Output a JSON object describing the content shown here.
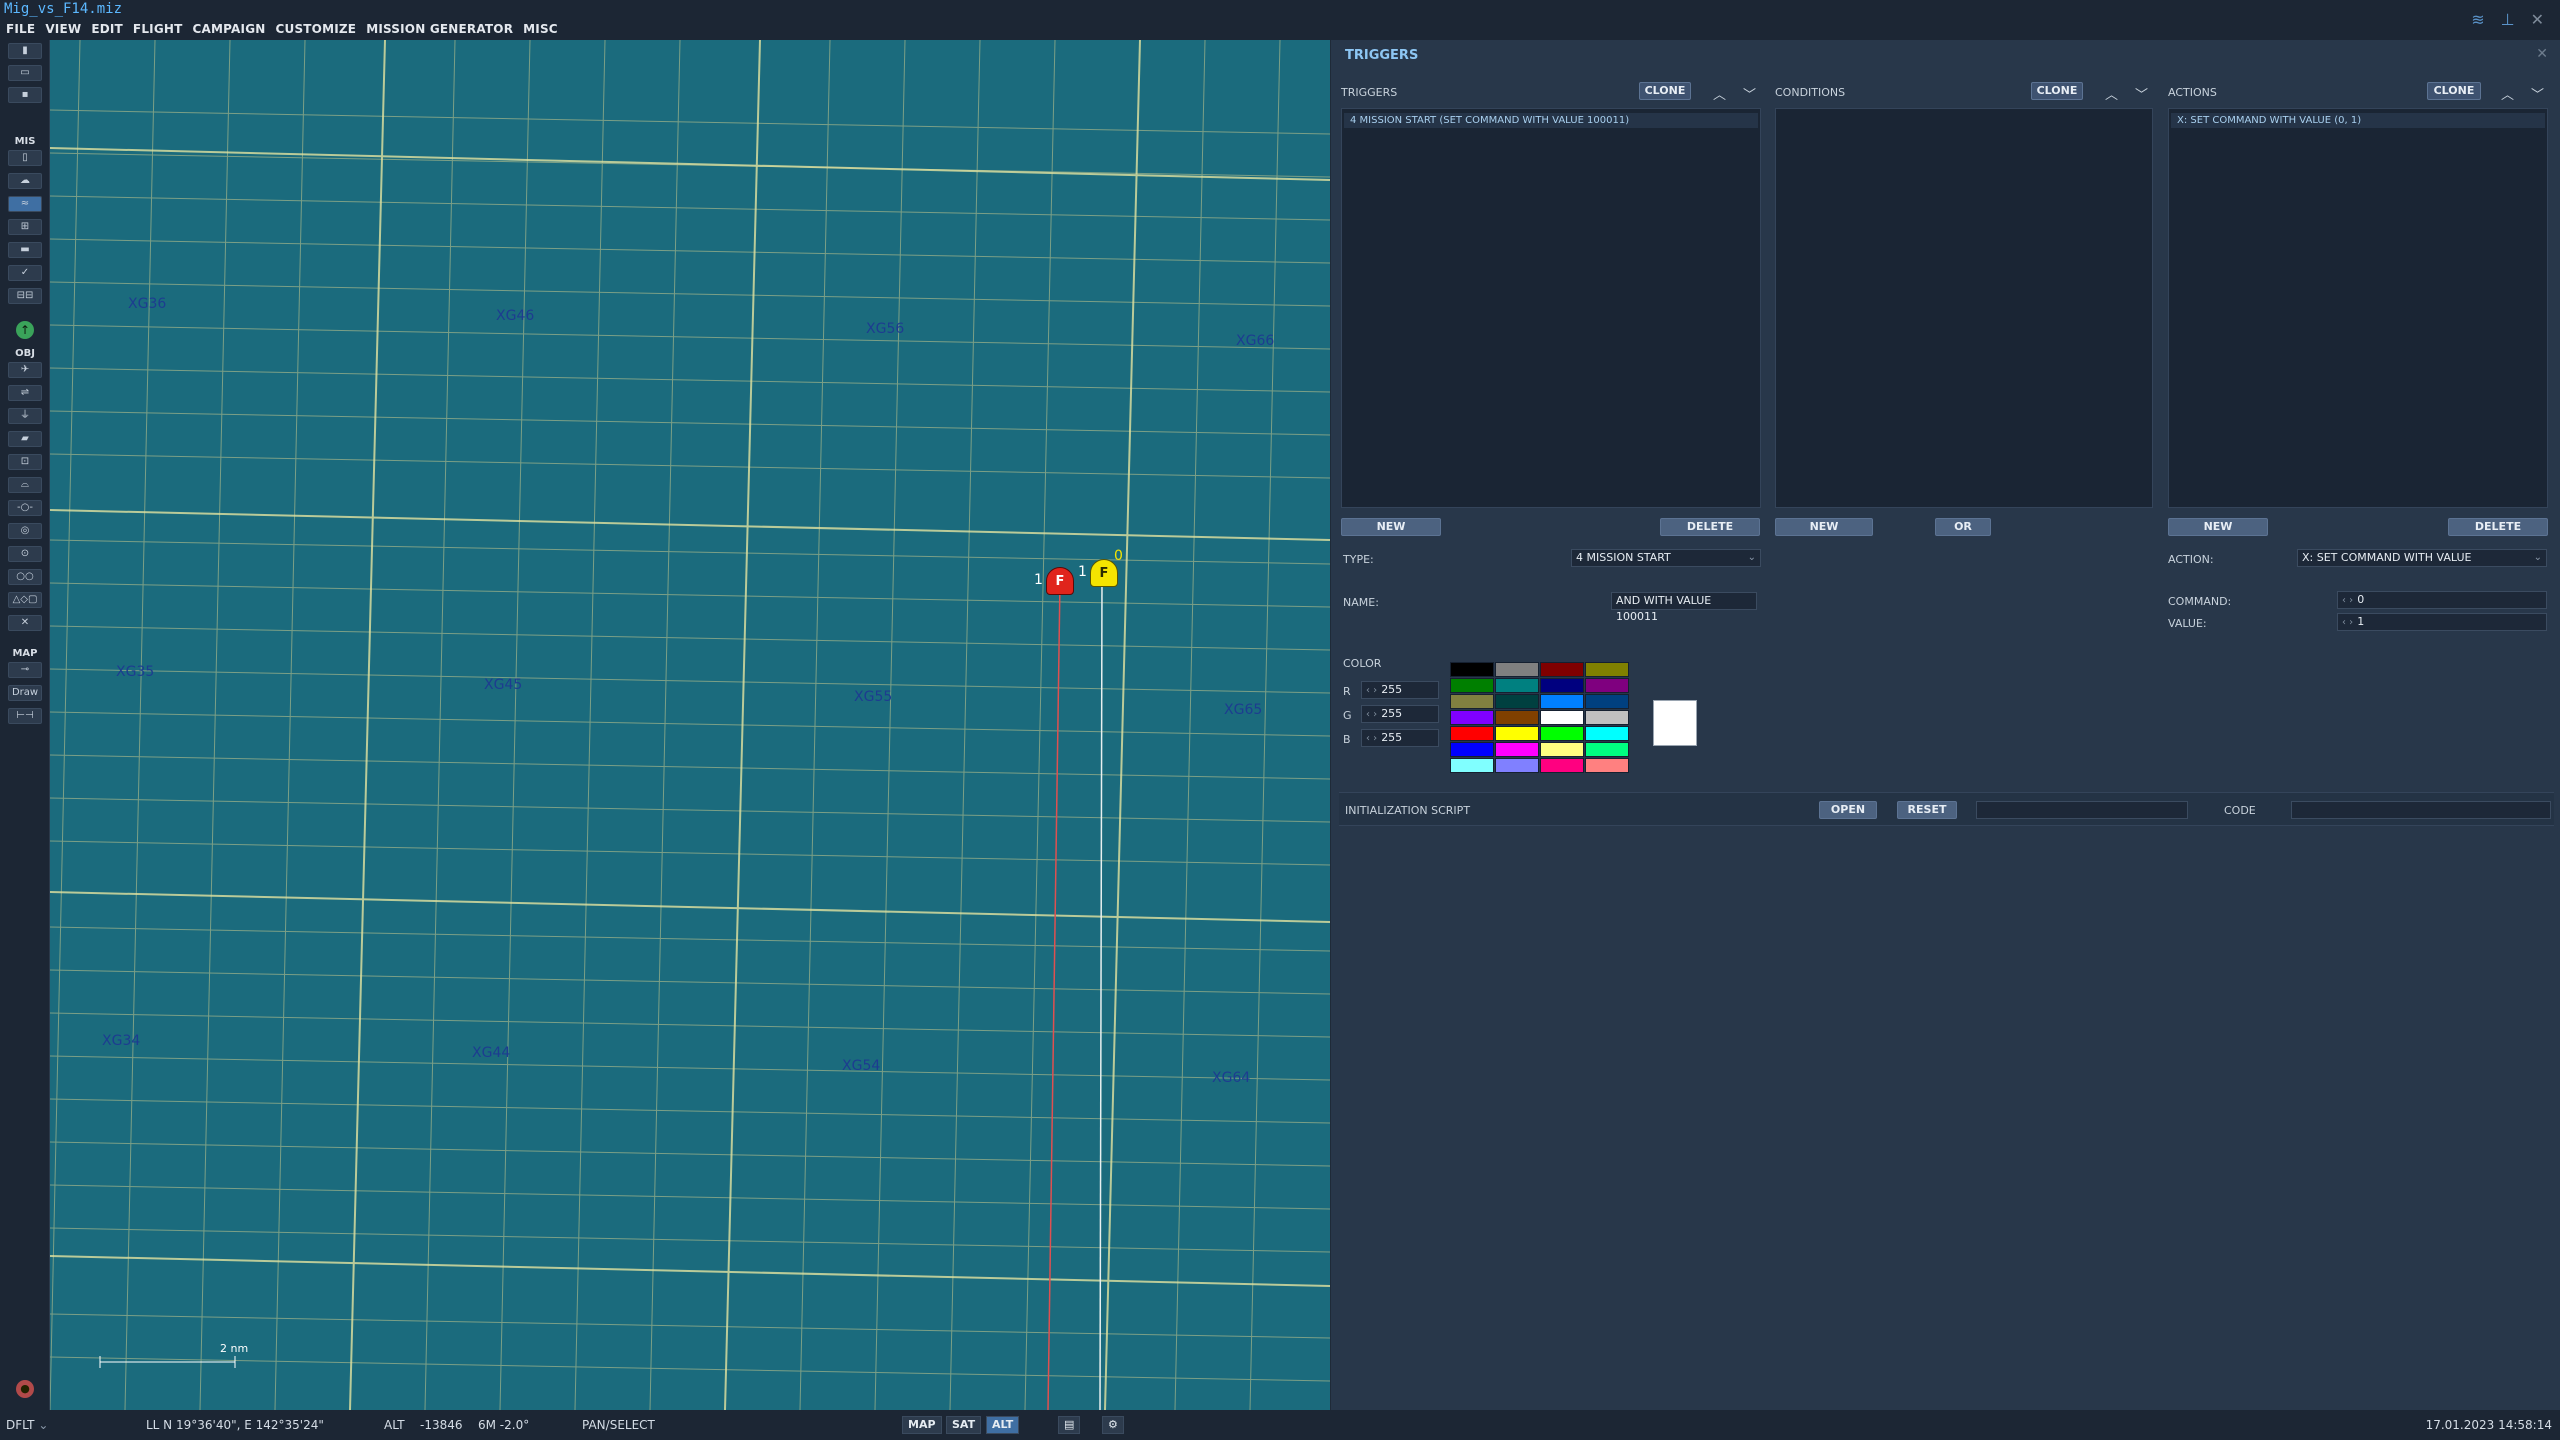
{
  "app": {
    "filename": "Mig_vs_F14.miz"
  },
  "menu": [
    "FILE",
    "VIEW",
    "EDIT",
    "FLIGHT",
    "CAMPAIGN",
    "CUSTOMIZE",
    "MISSION GENERATOR",
    "MISC"
  ],
  "toolbar": {
    "mis_label": "MIS",
    "obj_label": "OBJ",
    "map_label": "MAP",
    "draw_label": "Draw"
  },
  "map": {
    "grid_labels": [
      "XG36",
      "XG46",
      "XG56",
      "XG66",
      "XG35",
      "XG45",
      "XG55",
      "XG65",
      "XG34",
      "XG44",
      "XG54",
      "XG64"
    ],
    "scale_label": "2 nm",
    "units": [
      {
        "symbol": "F",
        "left_number": "1",
        "right_number": "1",
        "color": "#e0241c"
      },
      {
        "symbol": "F",
        "top_number": "0",
        "color": "#f5e400"
      }
    ]
  },
  "panel": {
    "title": "TRIGGERS",
    "triggers": {
      "header": "TRIGGERS",
      "clone": "CLONE",
      "items": [
        "4 MISSION START (SET COMMAND WITH VALUE 100011)"
      ],
      "new": "NEW",
      "delete": "DELETE",
      "type_label": "TYPE:",
      "type_value": "4 MISSION START",
      "name_label": "NAME:",
      "name_value": "AND WITH VALUE 100011",
      "color_label": "COLOR",
      "r_label": "R",
      "r_value": "255",
      "g_label": "G",
      "g_value": "255",
      "b_label": "B",
      "b_value": "255"
    },
    "conditions": {
      "header": "CONDITIONS",
      "clone": "CLONE",
      "new": "NEW",
      "or": "OR"
    },
    "actions": {
      "header": "ACTIONS",
      "clone": "CLONE",
      "items": [
        "X: SET COMMAND WITH VALUE (0, 1)"
      ],
      "new": "NEW",
      "delete": "DELETE",
      "action_label": "ACTION:",
      "action_value": "X: SET COMMAND WITH VALUE",
      "command_label": "COMMAND:",
      "command_value": "0",
      "value_label": "VALUE:",
      "value_value": "1"
    },
    "init": {
      "label": "INITIALIZATION SCRIPT",
      "open": "OPEN",
      "reset": "RESET",
      "code_label": "CODE"
    },
    "palette": [
      "#000000",
      "#808080",
      "#7f0000",
      "#808000",
      "#007f00",
      "#008080",
      "#00007f",
      "#7f007f",
      "#808040",
      "#004040",
      "#0080ff",
      "#004080",
      "#8000ff",
      "#804000",
      "#ffffff",
      "#c0c0c0",
      "#ff0000",
      "#ffff00",
      "#00ff00",
      "#00ffff",
      "#0000ff",
      "#ff00ff",
      "#ffff80",
      "#00ff80",
      "#80ffff",
      "#8080ff",
      "#ff0080",
      "#ff8080"
    ]
  },
  "status": {
    "layer": "DFLT",
    "ll": "LL  N 19°36'40\", E 142°35'24\"",
    "alt_label": "ALT",
    "alt_value": "-13846",
    "scale": "6M  -2.0°",
    "mode": "PAN/SELECT",
    "map_btn": "MAP",
    "sat_btn": "SAT",
    "alt_btn": "ALT",
    "datetime": "17.01.2023 14:58:14"
  }
}
